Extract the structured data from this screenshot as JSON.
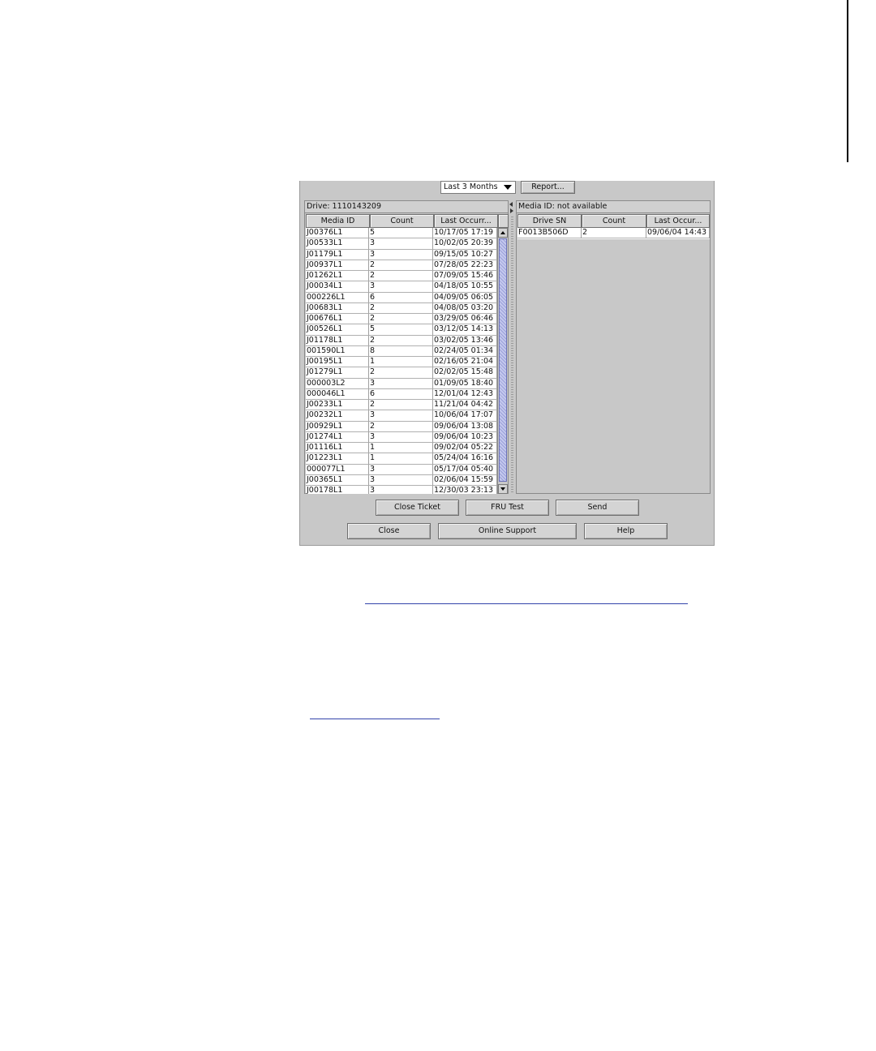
{
  "toolbar": {
    "period_selected": "Last 3 Months",
    "report_label": "Report..."
  },
  "left_panel": {
    "title": "Drive: 1110143209",
    "columns": [
      "Media ID",
      "Count",
      "Last Occurr..."
    ],
    "rows": [
      [
        "J00376L1",
        "5",
        "10/17/05 17:19"
      ],
      [
        "J00533L1",
        "3",
        "10/02/05 20:39"
      ],
      [
        "J01179L1",
        "3",
        "09/15/05 10:27"
      ],
      [
        "J00937L1",
        "2",
        "07/28/05 22:23"
      ],
      [
        "J01262L1",
        "2",
        "07/09/05 15:46"
      ],
      [
        "J00034L1",
        "3",
        "04/18/05 10:55"
      ],
      [
        "000226L1",
        "6",
        "04/09/05 06:05"
      ],
      [
        "J00683L1",
        "2",
        "04/08/05 03:20"
      ],
      [
        "J00676L1",
        "2",
        "03/29/05 06:46"
      ],
      [
        "J00526L1",
        "5",
        "03/12/05 14:13"
      ],
      [
        "J01178L1",
        "2",
        "03/02/05 13:46"
      ],
      [
        "001590L1",
        "8",
        "02/24/05 01:34"
      ],
      [
        "J00195L1",
        "1",
        "02/16/05 21:04"
      ],
      [
        "J01279L1",
        "2",
        "02/02/05 15:48"
      ],
      [
        "000003L2",
        "3",
        "01/09/05 18:40"
      ],
      [
        "000046L1",
        "6",
        "12/01/04 12:43"
      ],
      [
        "J00233L1",
        "2",
        "11/21/04 04:42"
      ],
      [
        "J00232L1",
        "3",
        "10/06/04 17:07"
      ],
      [
        "J00929L1",
        "2",
        "09/06/04 13:08"
      ],
      [
        "J01274L1",
        "3",
        "09/06/04 10:23"
      ],
      [
        "J01116L1",
        "1",
        "09/02/04 05:22"
      ],
      [
        "J01223L1",
        "1",
        "05/24/04 16:16"
      ],
      [
        "000077L1",
        "3",
        "05/17/04 05:40"
      ],
      [
        "J00365L1",
        "3",
        "02/06/04 15:59"
      ],
      [
        "J00178L1",
        "3",
        "12/30/03 23:13"
      ]
    ]
  },
  "right_panel": {
    "title": "Media ID: not available",
    "columns": [
      "Drive SN",
      "Count",
      "Last Occur..."
    ],
    "rows": [
      [
        "F0013B506D",
        "2",
        "09/06/04 14:43"
      ]
    ]
  },
  "buttons": {
    "close_ticket": "Close Ticket",
    "fru_test": "FRU Test",
    "send": "Send",
    "close": "Close",
    "online_support": "Online Support",
    "help": "Help"
  }
}
